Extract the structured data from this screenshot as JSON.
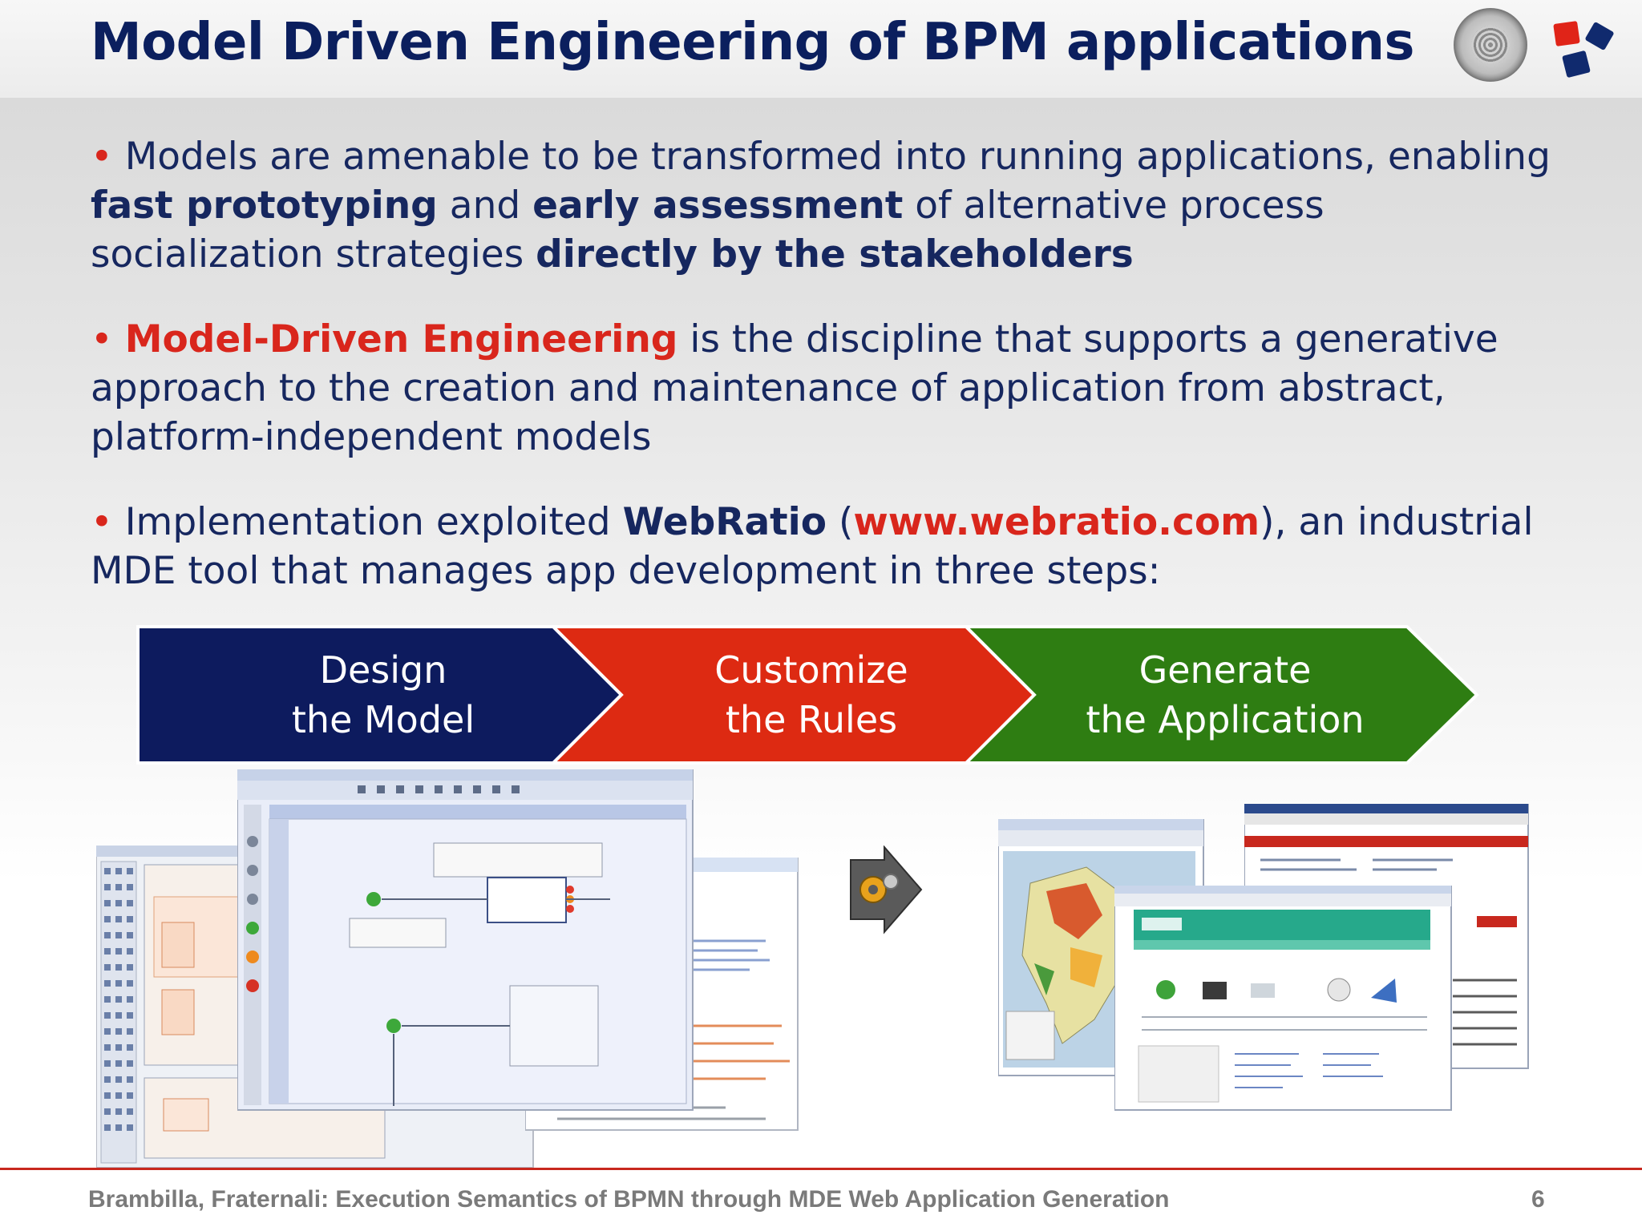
{
  "slide": {
    "title": "Model Driven Engineering of BPM applications",
    "page_number": "6",
    "footer": "Brambilla, Fraternali: Execution Semantics of BPMN through MDE Web Application Generation"
  },
  "bullets": [
    {
      "marker": "•",
      "t1": "Models are amenable to be transformed into running applications, enabling",
      "b1": "fast prototyping",
      "t2": "and",
      "b2": "early assessment",
      "t3": "of alternative process socialization strategies",
      "b3": "directly by the stakeholders"
    },
    {
      "marker": "•",
      "r1": "Model-Driven Engineering",
      "t1": "is the discipline that supports a generative approach to the creation and maintenance of application from abstract, platform-independent models"
    },
    {
      "marker": "•",
      "t1": "Implementation exploited",
      "b1": "WebRatio",
      "p_open": "(",
      "r1": "www.webratio.com",
      "t2": "),  an industrial MDE tool that manages app development in three steps:"
    }
  ],
  "steps": [
    {
      "line1": "Design",
      "line2": "the Model",
      "color": "#0d1b5e"
    },
    {
      "line1": "Customize",
      "line2": "the Rules",
      "color": "#dd2a12"
    },
    {
      "line1": "Generate",
      "line2": "the Application",
      "color": "#2e7d12"
    }
  ],
  "colors": {
    "title": "#0b1f5e",
    "text": "#16275f",
    "accent_red": "#d9261c",
    "footer_line": "#c8281e"
  },
  "icons": {
    "seal": "university-seal-icon",
    "logo": "webratio-logo-icon",
    "generate": "gear-arrow-icon"
  }
}
